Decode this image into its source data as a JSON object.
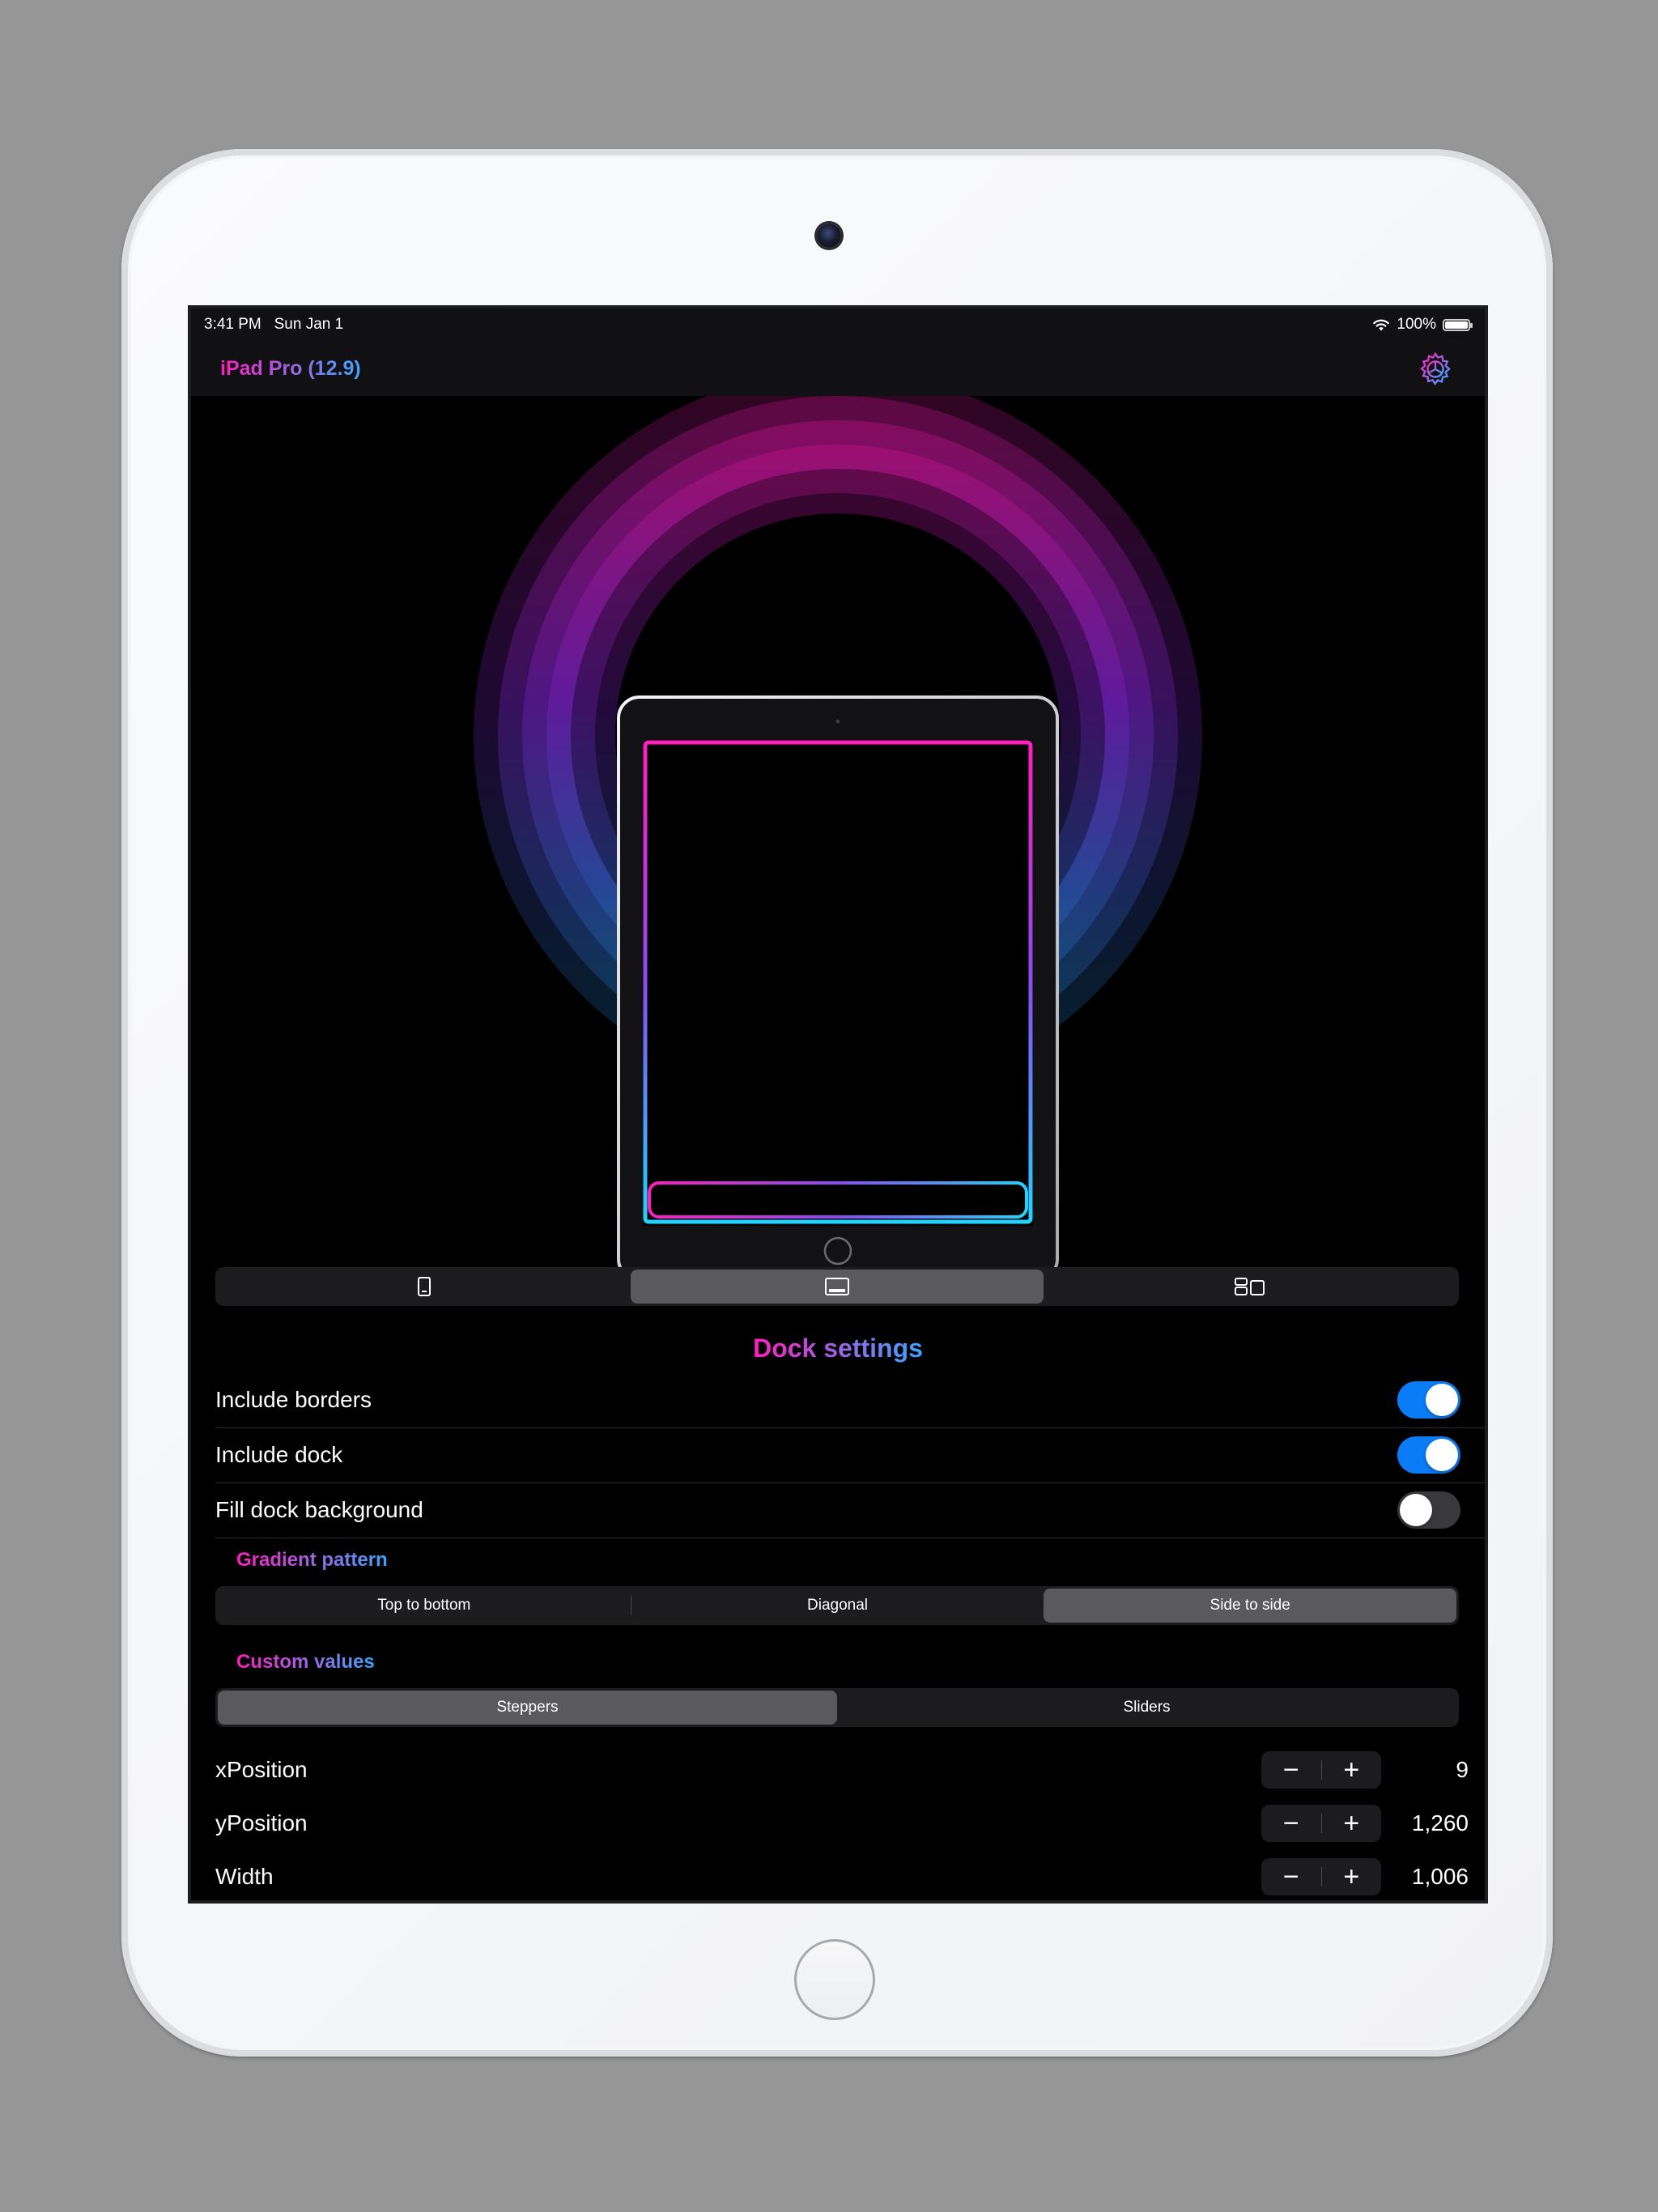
{
  "status_bar": {
    "time": "3:41 PM",
    "date": "Sun Jan 1",
    "battery": "100%",
    "battery_level": 1.0
  },
  "nav": {
    "title": "iPad Pro (12.9)",
    "settings_icon": "gear-icon"
  },
  "colors": {
    "accent_pink": "#ff1fbf",
    "accent_blue": "#3aa6ff",
    "toggle_on": "#0a7cf5"
  },
  "mode_tabs": {
    "items": [
      {
        "icon": "ipad-portrait-icon",
        "selected": false
      },
      {
        "icon": "dock-icon",
        "selected": true
      },
      {
        "icon": "split-view-icon",
        "selected": false
      }
    ]
  },
  "dock_settings": {
    "title": "Dock settings",
    "toggles": [
      {
        "label": "Include borders",
        "on": true
      },
      {
        "label": "Include dock",
        "on": true
      },
      {
        "label": "Fill dock background",
        "on": false
      }
    ]
  },
  "gradient_pattern": {
    "header": "Gradient pattern",
    "options": [
      "Top to bottom",
      "Diagonal",
      "Side to side"
    ],
    "selected": "Side to side"
  },
  "custom_values": {
    "header": "Custom values",
    "options": [
      "Steppers",
      "Sliders"
    ],
    "selected": "Steppers",
    "steppers": [
      {
        "label": "xPosition",
        "value": "9"
      },
      {
        "label": "yPosition",
        "value": "1,260"
      },
      {
        "label": "Width",
        "value": "1,006"
      }
    ]
  }
}
